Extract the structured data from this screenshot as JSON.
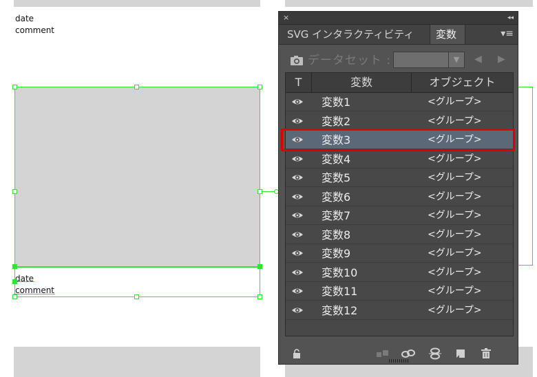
{
  "canvas": {
    "top_texts": [
      "date",
      "comment"
    ],
    "bottom_texts": [
      "date",
      "comment"
    ]
  },
  "panel": {
    "close_glyph": "×",
    "collapse_glyph": "◂◂",
    "tabs": [
      {
        "label": "SVG インタラクティビティ",
        "active": false
      },
      {
        "label": "変数",
        "active": true
      }
    ],
    "menu_glyph": "▾≡",
    "dataset": {
      "label": "データセット :",
      "select_value": "",
      "prev_glyph": "◀",
      "next_glyph": "▶"
    },
    "table": {
      "headers": [
        "T",
        "変数",
        "オブジェクト"
      ],
      "rows": [
        {
          "name": "変数1",
          "object": "<グループ>",
          "selected": false
        },
        {
          "name": "変数2",
          "object": "<グループ>",
          "selected": false
        },
        {
          "name": "変数3",
          "object": "<グループ>",
          "selected": true
        },
        {
          "name": "変数4",
          "object": "<グループ>",
          "selected": false
        },
        {
          "name": "変数5",
          "object": "<グループ>",
          "selected": false
        },
        {
          "name": "変数6",
          "object": "<グループ>",
          "selected": false
        },
        {
          "name": "変数7",
          "object": "<グループ>",
          "selected": false
        },
        {
          "name": "変数8",
          "object": "<グループ>",
          "selected": false
        },
        {
          "name": "変数9",
          "object": "<グループ>",
          "selected": false
        },
        {
          "name": "変数10",
          "object": "<グループ>",
          "selected": false
        },
        {
          "name": "変数11",
          "object": "<グループ>",
          "selected": false
        },
        {
          "name": "変数12",
          "object": "<グループ>",
          "selected": false
        }
      ]
    },
    "bottom_icons": [
      "lock-icon",
      "make-variables-icon",
      "bind-icon",
      "unbind-icon",
      "new-variable-icon",
      "trash-icon"
    ]
  },
  "colors": {
    "selection_green": "#2ee62e",
    "highlight_red": "#e00000",
    "selected_row": "#5b6878"
  }
}
